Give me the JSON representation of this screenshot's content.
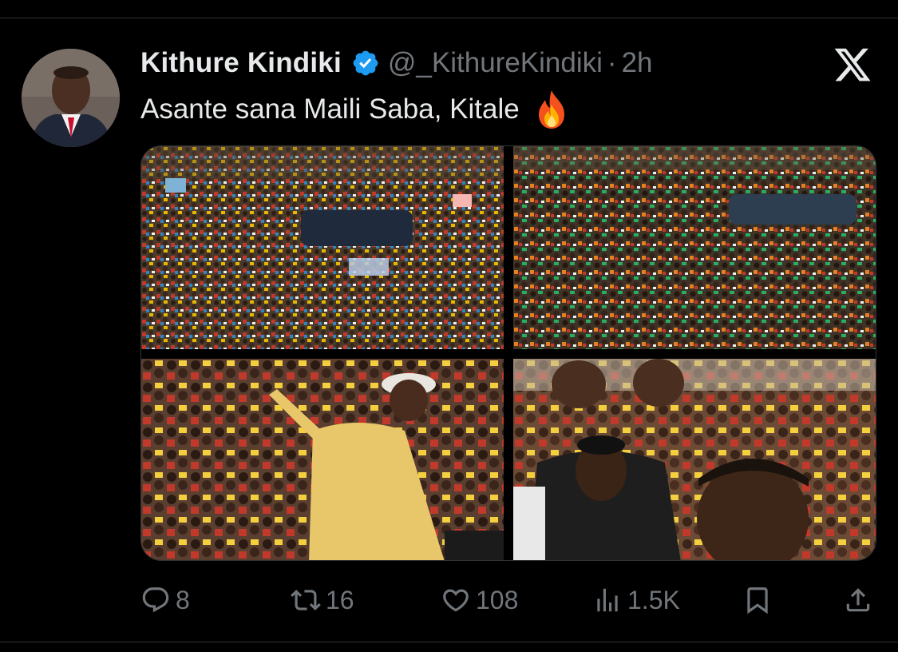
{
  "tweet": {
    "author_name": "Kithure Kindiki",
    "handle": "@_KithureKindiki",
    "separator": "·",
    "time": "2h",
    "text": "Asante sana Maili Saba, Kitale",
    "emoji": "fire-emoji",
    "verified_icon": "verified-badge-icon",
    "verified_color": "#1d9bf0"
  },
  "media": {
    "count": 4,
    "tiles": [
      "crowd-photo-1",
      "crowd-photo-2",
      "speaker-photo",
      "supporters-photo"
    ]
  },
  "actions": {
    "replies": "8",
    "reposts": "16",
    "likes": "108",
    "views": "1.5K",
    "bookmark_icon": "bookmark-icon",
    "share_icon": "share-icon"
  },
  "colors": {
    "background": "#000000",
    "text": "#e7e9ea",
    "muted": "#71767b",
    "divider": "#2f3336"
  }
}
